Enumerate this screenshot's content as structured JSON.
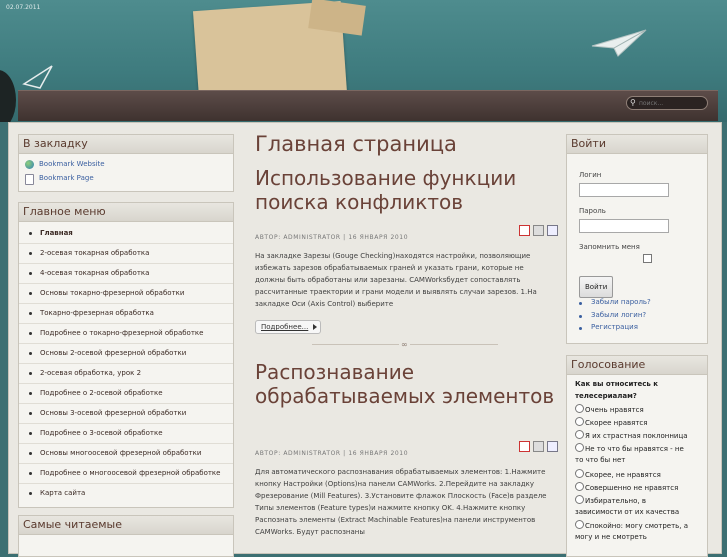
{
  "header": {
    "date": "02.07.2011",
    "search_placeholder": "поиск..."
  },
  "bookmarks": {
    "title": "В закладку",
    "items": [
      {
        "label": "Bookmark Website",
        "icon": "globe-icon"
      },
      {
        "label": "Bookmark Page",
        "icon": "page-icon"
      }
    ]
  },
  "main_menu": {
    "title": "Главное меню",
    "items": [
      {
        "label": "Главная",
        "current": true
      },
      {
        "label": "2-осевая токарная обработка"
      },
      {
        "label": "4-осевая токарная обработка"
      },
      {
        "label": "Основы токарно-фрезерной обработки"
      },
      {
        "label": "Токарно-фрезерная обработка"
      },
      {
        "label": "Подробнее о токарно-фрезерной обработке"
      },
      {
        "label": "Основы 2-осевой фрезерной обработки"
      },
      {
        "label": "2-осевая обработка, урок 2"
      },
      {
        "label": "Подробнее о 2-осевой обработке"
      },
      {
        "label": "Основы 3-осевой фрезерной обработки"
      },
      {
        "label": "Подробнее о 3-осевой обработке"
      },
      {
        "label": "Основы многоосевой фрезерной обработки"
      },
      {
        "label": "Подробнее о многоосевой фрезерной обработке"
      },
      {
        "label": "Карта сайта"
      }
    ]
  },
  "popular": {
    "title": "Самые читаемые"
  },
  "content": {
    "page_title": "Главная страница",
    "articles": [
      {
        "title": "Использование функции поиска конфликтов",
        "meta": "АВТОР: ADMINISTRATOR | 16 ЯНВАРЯ 2010",
        "text": "На закладке Зарезы (Gouge Checking)находятся настройки, позволяющие избежать зарезов обрабатываемых граней и указать грани, которые не должны быть обработаны или зарезаны.  CAMWorksбудет сопоставлять рассчитанные траектории и грани модели и выявлять случаи зарезов. 1.На закладке Оси (Axis Control) выберите",
        "more": "Подробнее..."
      },
      {
        "title": "Распознавание обрабатываемых элементов",
        "meta": "АВТОР: ADMINISTRATOR | 16 ЯНВАРЯ 2010",
        "text": "Для автоматического распознавания обрабатываемых элементов: 1.Нажмите кнопку Настройки (Options)на панели CAMWorks. 2.Перейдите на закладку Фрезерование (Mill Features). 3.Установите флажок Плоскость (Face)в разделе Типы элементов (Feature types)и нажмите кнопку OK. 4.Нажмите кнопку Распознать элементы (Extract Machinable Features)на панели инструментов CAMWorks. Будут распознаны"
      }
    ]
  },
  "login": {
    "title": "Войти",
    "login_label": "Логин",
    "password_label": "Пароль",
    "remember_label": "Запомнить меня",
    "submit": "Войти",
    "links": [
      "Забыли пароль?",
      "Забыли логин?",
      "Регистрация"
    ]
  },
  "poll": {
    "title": "Голосование",
    "question": "Как вы относитесь к телесериалам?",
    "options": [
      "Очень нравятся",
      "Скорее нравятся",
      "Я их страстная поклонница",
      "Не то что бы нравятся - не то что бы нет",
      "Скорее, не нравятся",
      "Совершенно не нравятся",
      "Избирательно, в зависимости от их качества",
      "Спокойно: могу смотреть, а могу и не смотреть"
    ]
  }
}
